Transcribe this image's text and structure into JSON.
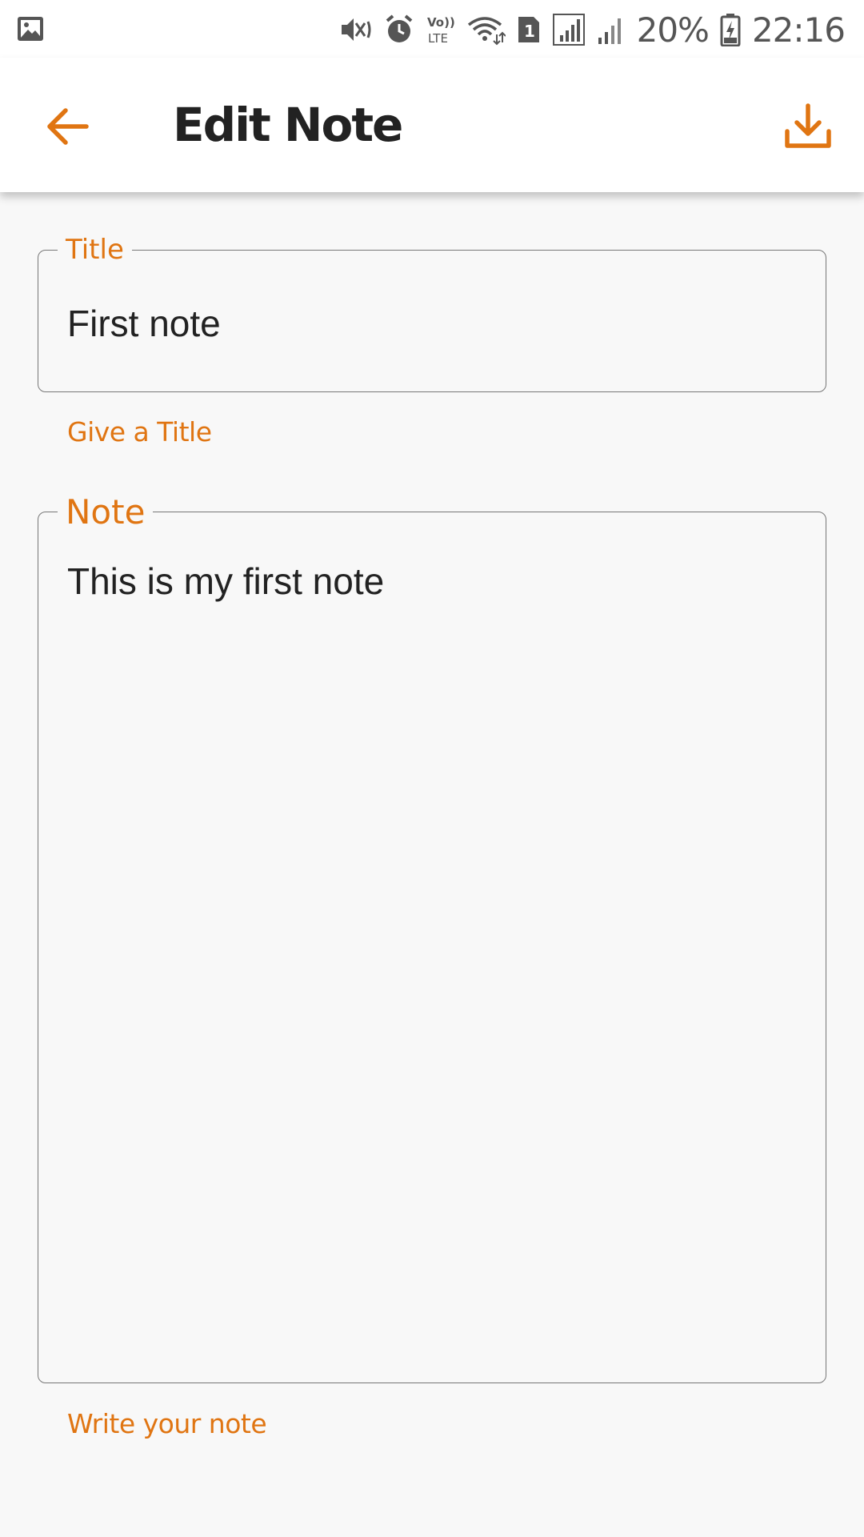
{
  "status_bar": {
    "battery_percent": "20%",
    "time": "22:16",
    "sim_slot": "1",
    "volte_label": "Vo)) LTE",
    "icons": [
      "gallery-icon",
      "mute-vibrate-icon",
      "alarm-icon",
      "volte-icon",
      "wifi-icon",
      "sim-1-icon",
      "signal-icon",
      "signal-icon-2",
      "battery-charging-icon"
    ]
  },
  "app_bar": {
    "title": "Edit Note",
    "back_icon": "arrow-left-icon",
    "save_icon": "download-icon"
  },
  "form": {
    "title_field": {
      "label": "Title",
      "value": "First note",
      "helper": "Give a Title"
    },
    "note_field": {
      "label": "Note",
      "value": "This is my first note",
      "helper": "Write your note"
    }
  },
  "colors": {
    "accent": "#E07512",
    "background": "#F8F8F8",
    "text": "#222222"
  }
}
